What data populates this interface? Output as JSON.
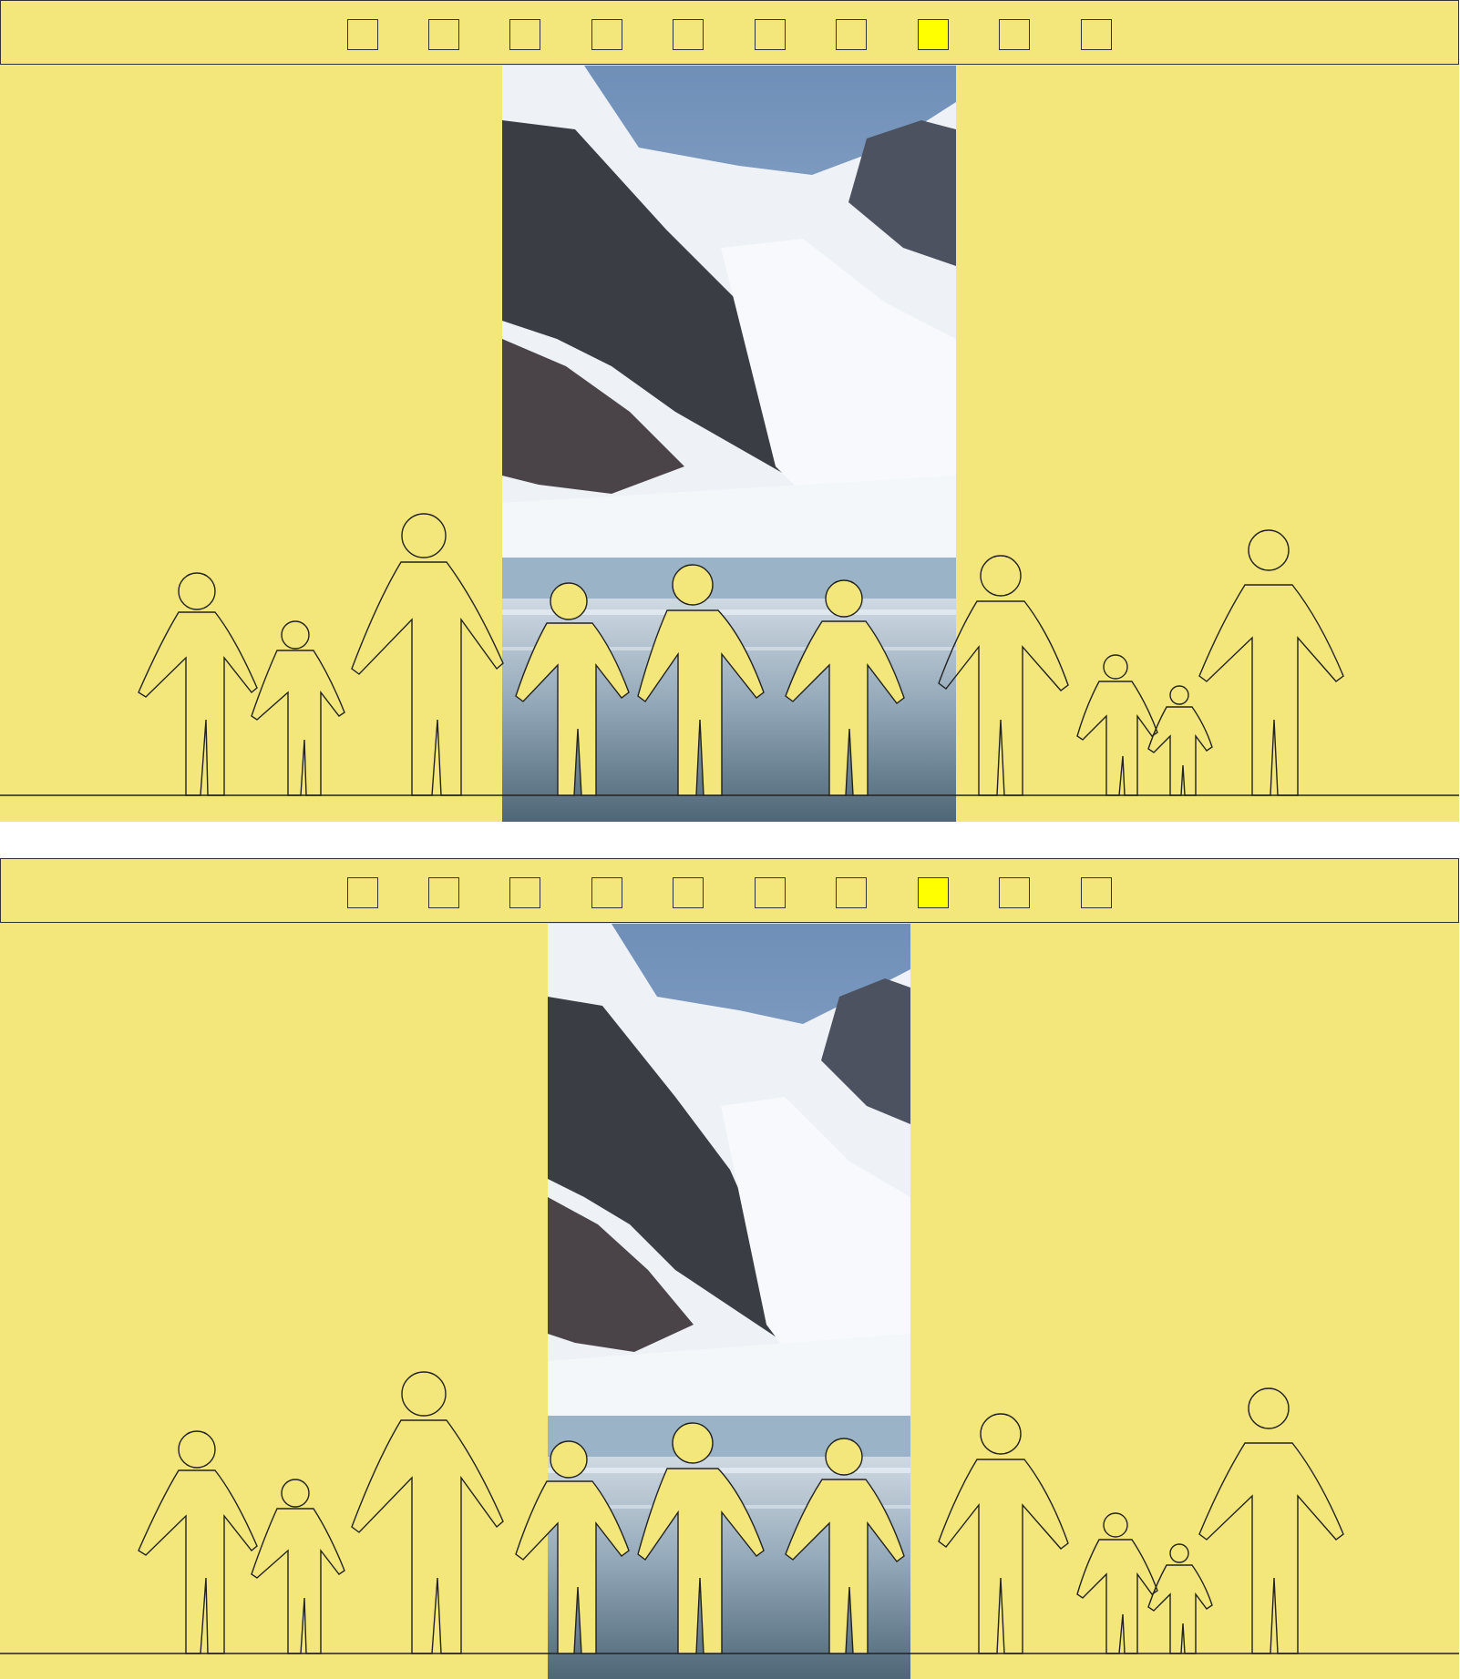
{
  "slides": [
    {
      "dots": [
        "",
        "",
        "",
        "",
        "",
        "",
        "",
        "",
        "",
        ""
      ],
      "active_dot": 7,
      "photo_icon": "glacier-photo",
      "figures_left": [
        "adult",
        "child",
        "adult"
      ],
      "figures_center": [
        "child",
        "adult",
        "adult"
      ],
      "figures_right": [
        "adult",
        "child",
        "child",
        "adult"
      ]
    },
    {
      "dots": [
        "",
        "",
        "",
        "",
        "",
        "",
        "",
        "",
        "",
        ""
      ],
      "active_dot": 7,
      "photo_icon": "glacier-photo",
      "figures_left": [
        "adult",
        "child",
        "adult"
      ],
      "figures_center": [
        "child",
        "adult",
        "adult"
      ],
      "figures_right": [
        "adult",
        "child",
        "child",
        "adult"
      ]
    }
  ],
  "colors": {
    "panel": "#f3e77b",
    "active_dot": "#ffff00",
    "outline": "#222222"
  }
}
